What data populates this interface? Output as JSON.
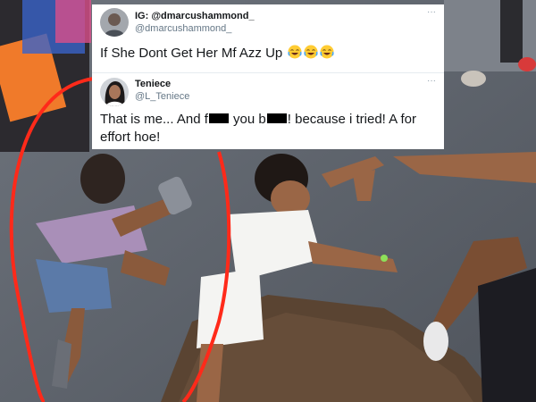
{
  "tweet1": {
    "avatar_icon": "user-avatar-icon",
    "display_name": "IG: @dmarcushammond_",
    "handle": "@dmarcushammond_",
    "more_icon": "more-options-icon",
    "more_label": "···",
    "text": "If She Dont Get Her Mf Azz Up",
    "emojis": [
      "face-with-tears-of-joy-icon",
      "face-with-tears-of-joy-icon",
      "face-with-tears-of-joy-icon"
    ]
  },
  "tweet2": {
    "avatar_icon": "user-avatar-icon",
    "display_name": "Teniece",
    "handle": "@L_Teniece",
    "more_icon": "more-options-icon",
    "more_label": "···",
    "text_line1_a": "That is me... And f",
    "text_line1_b": " you b",
    "text_line1_c": "! because i tried! A for",
    "text_line2": "effort hoe!",
    "censor_icon": "censor-bar-icon"
  },
  "photo": {
    "highlight_color": "#ff2a1a",
    "highlight_icon": "red-circle-highlight-icon"
  },
  "colors": {
    "card_bg": "#ffffff",
    "text": "#14171a",
    "muted": "#657786"
  }
}
